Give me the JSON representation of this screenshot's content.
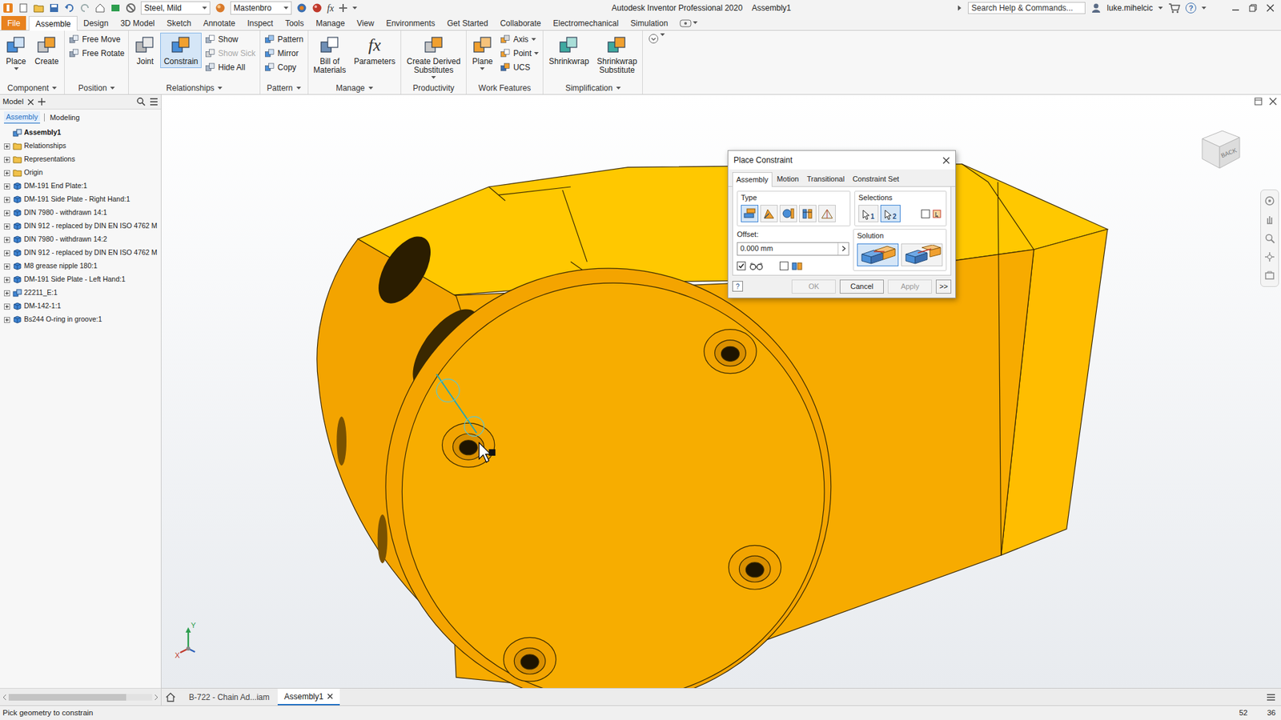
{
  "title_bar": {
    "app_title": "Autodesk Inventor Professional 2020",
    "document": "Assembly1",
    "material": "Steel, Mild",
    "appearance": "Mastenbro",
    "formula": "fx",
    "search_placeholder": "Search Help & Commands...",
    "user": "luke.mihelcic",
    "help": "?"
  },
  "ribbon_tabs": [
    {
      "label": "File",
      "kind": "menu",
      "selected": false
    },
    {
      "label": "Assemble",
      "kind": "tab",
      "selected": true
    },
    {
      "label": "Design",
      "kind": "tab",
      "selected": false
    },
    {
      "label": "3D Model",
      "kind": "tab",
      "selected": false
    },
    {
      "label": "Sketch",
      "kind": "tab",
      "selected": false
    },
    {
      "label": "Annotate",
      "kind": "tab",
      "selected": false
    },
    {
      "label": "Inspect",
      "kind": "tab",
      "selected": false
    },
    {
      "label": "Tools",
      "kind": "tab",
      "selected": false
    },
    {
      "label": "Manage",
      "kind": "tab",
      "selected": false
    },
    {
      "label": "View",
      "kind": "tab",
      "selected": false
    },
    {
      "label": "Environments",
      "kind": "tab",
      "selected": false
    },
    {
      "label": "Get Started",
      "kind": "tab",
      "selected": false
    },
    {
      "label": "Collaborate",
      "kind": "tab",
      "selected": false
    },
    {
      "label": "Electromechanical",
      "kind": "tab",
      "selected": false
    },
    {
      "label": "Simulation",
      "kind": "tab",
      "selected": false
    }
  ],
  "ribbon_panels": [
    {
      "title": "Component",
      "menu": true,
      "buttons": [
        {
          "kind": "large",
          "lines": [
            "Place"
          ],
          "selected": false,
          "disabled": false,
          "menu": true
        },
        {
          "kind": "large",
          "lines": [
            "Create"
          ],
          "selected": false,
          "disabled": false,
          "menu": false
        }
      ]
    },
    {
      "title": "Position",
      "menu": true,
      "buttons": [
        {
          "kind": "small",
          "lines": [
            "Free Move"
          ],
          "selected": false,
          "disabled": false,
          "menu": false
        },
        {
          "kind": "small",
          "lines": [
            "Free Rotate"
          ],
          "selected": false,
          "disabled": false,
          "menu": false
        }
      ]
    },
    {
      "title": "Relationships",
      "menu": true,
      "buttons": [
        {
          "kind": "large",
          "lines": [
            "Joint"
          ],
          "selected": false,
          "disabled": false,
          "menu": false
        },
        {
          "kind": "large",
          "lines": [
            "Constrain"
          ],
          "selected": true,
          "disabled": false,
          "menu": false
        },
        {
          "kind": "small",
          "lines": [
            "Show"
          ],
          "selected": false,
          "disabled": false,
          "menu": false
        },
        {
          "kind": "small",
          "lines": [
            "Show Sick"
          ],
          "selected": false,
          "disabled": true,
          "menu": false
        },
        {
          "kind": "small",
          "lines": [
            "Hide All"
          ],
          "selected": false,
          "disabled": false,
          "menu": false
        }
      ]
    },
    {
      "title": "Pattern",
      "menu": true,
      "buttons": [
        {
          "kind": "small",
          "lines": [
            "Pattern"
          ],
          "selected": false,
          "disabled": false,
          "menu": false
        },
        {
          "kind": "small",
          "lines": [
            "Mirror"
          ],
          "selected": false,
          "disabled": false,
          "menu": false
        },
        {
          "kind": "small",
          "lines": [
            "Copy"
          ],
          "selected": false,
          "disabled": false,
          "menu": false
        }
      ]
    },
    {
      "title": "Manage",
      "menu": true,
      "buttons": [
        {
          "kind": "large",
          "lines": [
            "Bill of",
            "Materials"
          ],
          "selected": false,
          "disabled": false,
          "menu": false
        },
        {
          "kind": "large",
          "lines": [
            "Parameters"
          ],
          "icon_text": "fx",
          "selected": false,
          "disabled": false,
          "menu": false
        }
      ]
    },
    {
      "title": "Productivity",
      "menu": false,
      "buttons": [
        {
          "kind": "large",
          "lines": [
            "Create Derived",
            "Substitutes"
          ],
          "selected": false,
          "disabled": false,
          "menu": true
        }
      ]
    },
    {
      "title": "Work Features",
      "menu": false,
      "buttons": [
        {
          "kind": "large",
          "lines": [
            "Plane"
          ],
          "selected": false,
          "disabled": false,
          "menu": true
        },
        {
          "kind": "small",
          "lines": [
            "Axis"
          ],
          "selected": false,
          "disabled": false,
          "menu": true
        },
        {
          "kind": "small",
          "lines": [
            "Point"
          ],
          "selected": false,
          "disabled": false,
          "menu": true
        },
        {
          "kind": "small",
          "lines": [
            "UCS"
          ],
          "selected": false,
          "disabled": false,
          "menu": false
        }
      ]
    },
    {
      "title": "Simplification",
      "menu": true,
      "buttons": [
        {
          "kind": "large",
          "lines": [
            "Shrinkwrap"
          ],
          "selected": false,
          "disabled": false,
          "menu": false
        },
        {
          "kind": "large",
          "lines": [
            "Shrinkwrap",
            "Substitute"
          ],
          "selected": false,
          "disabled": false,
          "menu": false
        }
      ]
    }
  ],
  "browser": {
    "tab": "Model",
    "sub_tabs": [
      {
        "label": "Assembly",
        "selected": true
      },
      {
        "label": "Modeling",
        "selected": false
      }
    ],
    "tree": [
      {
        "label": "Assembly1",
        "kind": "root",
        "expanded": true
      },
      {
        "label": "Relationships",
        "kind": "folder",
        "expanded": false
      },
      {
        "label": "Representations",
        "kind": "folder",
        "expanded": false
      },
      {
        "label": "Origin",
        "kind": "folder",
        "expanded": false
      },
      {
        "label": "DM-191  End Plate:1",
        "kind": "part",
        "expanded": false
      },
      {
        "label": "DM-191  Side Plate - Right Hand:1",
        "kind": "part",
        "expanded": false
      },
      {
        "label": "DIN 7980 - withdrawn 14:1",
        "kind": "part",
        "expanded": false
      },
      {
        "label": "DIN 912 - replaced by DIN EN ISO 4762 M",
        "kind": "part",
        "expanded": false
      },
      {
        "label": "DIN 7980 - withdrawn 14:2",
        "kind": "part",
        "expanded": false
      },
      {
        "label": "DIN 912 - replaced by DIN EN ISO 4762 M",
        "kind": "part",
        "expanded": false
      },
      {
        "label": "M8 grease nipple 180:1",
        "kind": "part",
        "expanded": false
      },
      {
        "label": "DM-191  Side Plate - Left Hand:1",
        "kind": "part",
        "expanded": false
      },
      {
        "label": "22211_E:1",
        "kind": "assembly",
        "expanded": false
      },
      {
        "label": "DM-142-1:1",
        "kind": "part",
        "expanded": false
      },
      {
        "label": "Bs244 O-ring in groove:1",
        "kind": "part",
        "expanded": false
      }
    ]
  },
  "dialog": {
    "title": "Place Constraint",
    "tabs": [
      {
        "label": "Assembly",
        "selected": true
      },
      {
        "label": "Motion",
        "selected": false
      },
      {
        "label": "Transitional",
        "selected": false
      },
      {
        "label": "Constraint Set",
        "selected": false
      }
    ],
    "type_label": "Type",
    "types": [
      {
        "selected": true
      },
      {
        "selected": false
      },
      {
        "selected": false
      },
      {
        "selected": false
      },
      {
        "selected": false
      }
    ],
    "selections_label": "Selections",
    "selections": [
      {
        "label": "1",
        "selected": false
      },
      {
        "label": "2",
        "selected": true
      }
    ],
    "pick_part_first": false,
    "offset_label": "Offset:",
    "offset_value": "0.000 mm",
    "solution_label": "Solution",
    "solutions": [
      {
        "selected": true
      },
      {
        "selected": false
      }
    ],
    "show_preview": true,
    "predict_offset": false,
    "help": "?",
    "buttons": [
      {
        "label": "OK",
        "disabled": true
      },
      {
        "label": "Cancel",
        "disabled": false
      },
      {
        "label": "Apply",
        "disabled": true
      },
      {
        "label": ">>",
        "disabled": false
      }
    ]
  },
  "viewport": {
    "view_cube": "BACK",
    "triad": [
      "Y",
      "X"
    ]
  },
  "document_tabs": [
    {
      "label": "B-722 - Chain Ad...iam",
      "selected": false,
      "closable": false
    },
    {
      "label": "Assembly1",
      "selected": true,
      "closable": true
    }
  ],
  "status_bar": {
    "message": "Pick geometry to constrain",
    "values": [
      "52",
      "36"
    ]
  }
}
